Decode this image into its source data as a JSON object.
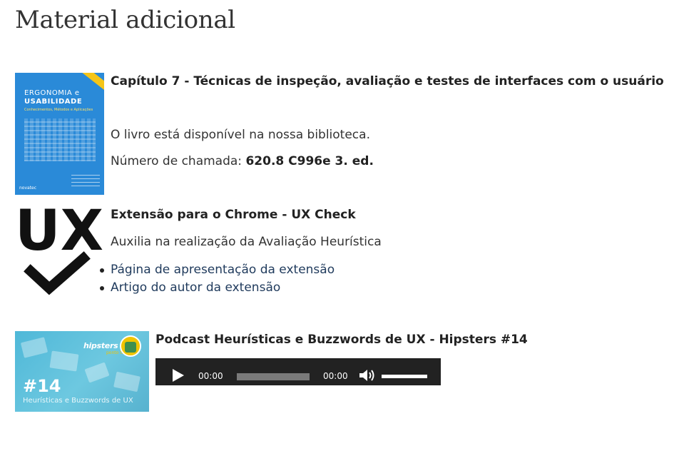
{
  "page": {
    "title": "Material adicional"
  },
  "book": {
    "heading": "Capítulo 7 - Técnicas de inspeção, avaliação e testes de interfaces com o usuário",
    "availability": "O livro está disponível na nossa biblioteca.",
    "call_number_label": "Número de chamada: ",
    "call_number_value": "620.8 C996e 3. ed.",
    "cover": {
      "title_line1": "ERGONOMIA e",
      "title_line2": "USABILIDADE",
      "subtitle": "Conhecimentos, Métodos e Aplicações",
      "publisher": "novatec",
      "color": "#2a8ad8"
    }
  },
  "ux_check": {
    "heading": "Extensão para o Chrome - UX Check",
    "description": "Auxilia na realização da Avaliação Heurística",
    "logo_text": "UX",
    "links": [
      {
        "label": "Página de apresentação da extensão"
      },
      {
        "label": "Artigo do autor da extensão"
      }
    ]
  },
  "podcast": {
    "heading": "Podcast Heurísticas e Buzzwords de UX - Hipsters #14",
    "thumbnail": {
      "brand": "hipsters",
      "brand_sub": "ponto tech",
      "episode": "#14",
      "subtitle": "Heurísticas e Buzzwords de UX"
    },
    "player": {
      "current_time": "00:00",
      "duration": "00:00",
      "play_icon": "play-icon",
      "mute_icon": "speaker-icon"
    }
  }
}
